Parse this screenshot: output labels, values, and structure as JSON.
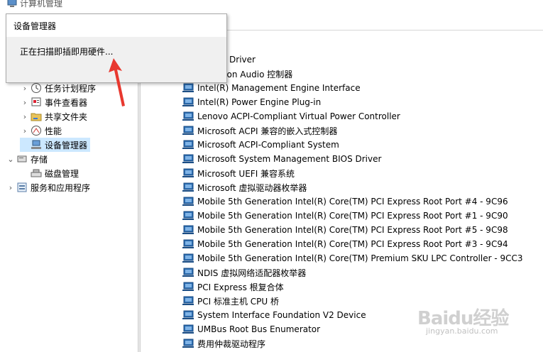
{
  "window": {
    "title": "计算机管理"
  },
  "popup": {
    "title": "设备管理器",
    "message": "正在扫描即插即用硬件..."
  },
  "tree": [
    {
      "label": "任务计划程序",
      "icon": "clock-icon",
      "indent": 1,
      "expander": "›"
    },
    {
      "label": "事件查看器",
      "icon": "event-viewer-icon",
      "indent": 1,
      "expander": "›"
    },
    {
      "label": "共享文件夹",
      "icon": "shared-folder-icon",
      "indent": 1,
      "expander": "›"
    },
    {
      "label": "性能",
      "icon": "performance-icon",
      "indent": 1,
      "expander": "›"
    },
    {
      "label": "设备管理器",
      "icon": "device-manager-icon",
      "indent": 1,
      "expander": "",
      "selected": true
    },
    {
      "label": "存储",
      "icon": "storage-icon",
      "indent": 0,
      "expander": "⌄"
    },
    {
      "label": "磁盘管理",
      "icon": "disk-management-icon",
      "indent": 1,
      "expander": ""
    },
    {
      "label": "服务和应用程序",
      "icon": "services-icon",
      "indent": 0,
      "expander": "›"
    }
  ],
  "devices": [
    {
      "label": "UMBus Driver",
      "partial": true
    },
    {
      "label": "definition Audio 控制器",
      "partial": true
    },
    {
      "label": "Intel(R) Management Engine Interface"
    },
    {
      "label": "Intel(R) Power Engine Plug-in"
    },
    {
      "label": "Lenovo ACPI-Compliant Virtual Power Controller"
    },
    {
      "label": "Microsoft ACPI 兼容的嵌入式控制器"
    },
    {
      "label": "Microsoft ACPI-Compliant System"
    },
    {
      "label": "Microsoft System Management BIOS Driver"
    },
    {
      "label": "Microsoft UEFI 兼容系统"
    },
    {
      "label": "Microsoft 虚拟驱动器枚举器"
    },
    {
      "label": "Mobile 5th Generation Intel(R) Core(TM) PCI Express Root Port #4 - 9C96"
    },
    {
      "label": "Mobile 5th Generation Intel(R) Core(TM) PCI Express Root Port #1 - 9C90"
    },
    {
      "label": "Mobile 5th Generation Intel(R) Core(TM) PCI Express Root Port #5 - 9C98"
    },
    {
      "label": "Mobile 5th Generation Intel(R) Core(TM) PCI Express Root Port #3 - 9C94"
    },
    {
      "label": "Mobile 5th Generation Intel(R) Core(TM) Premium SKU LPC Controller - 9CC3"
    },
    {
      "label": "NDIS 虚拟网络适配器枚举器"
    },
    {
      "label": "PCI Express 根复合体"
    },
    {
      "label": "PCI 标准主机 CPU 桥"
    },
    {
      "label": "System Interface Foundation V2 Device"
    },
    {
      "label": "UMBus Root Bus Enumerator"
    },
    {
      "label": "费用仲裁驱动程序"
    }
  ],
  "watermark": {
    "logo": "Baidu经验",
    "url": "jingyan.baidu.com"
  },
  "colors": {
    "selection": "#cce8ff",
    "device_icon": "#2b6cb0",
    "arrow": "#e8382f"
  }
}
